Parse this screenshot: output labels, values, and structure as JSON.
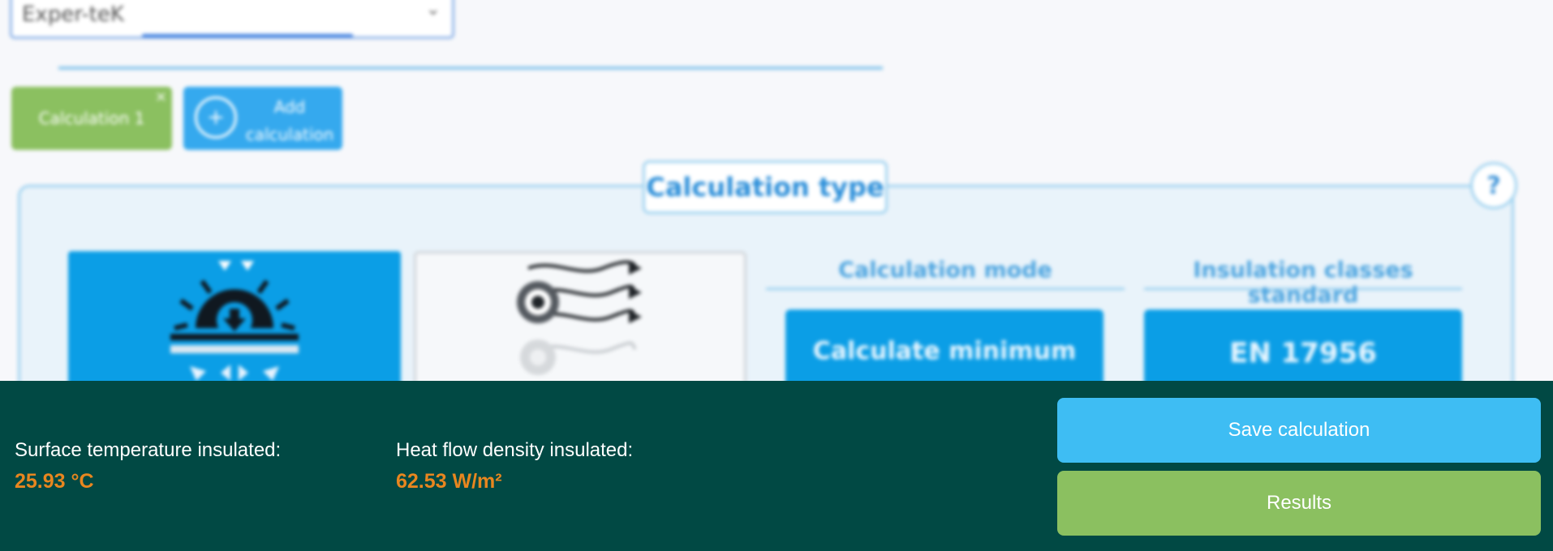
{
  "manufacturer_select": {
    "value": "Exper-teK"
  },
  "tabs": {
    "calculation_1": {
      "label": "Calculation 1",
      "close": "×"
    },
    "add_calculation": {
      "label": "Add calculation",
      "plus": "+"
    }
  },
  "calc_type": {
    "title": "Calculation type",
    "help": "?",
    "mode_heading": "Calculation mode",
    "mode_button": "Calculate minimum",
    "standard_heading": "Insulation classes standard",
    "standard_button": "EN 17956"
  },
  "footer": {
    "surface_label": "Surface temperature insulated:",
    "surface_value": "25.93 °C",
    "heat_label": "Heat flow density insulated:",
    "heat_value": "62.53 W/m²",
    "save_label": "Save calculation",
    "results_label": "Results"
  },
  "colors": {
    "footer_bg": "#014944",
    "accent_orange": "#e8861f",
    "save_blue": "#3ebdf3",
    "results_green": "#8bc060",
    "primary_blue": "#0b9ee6"
  }
}
